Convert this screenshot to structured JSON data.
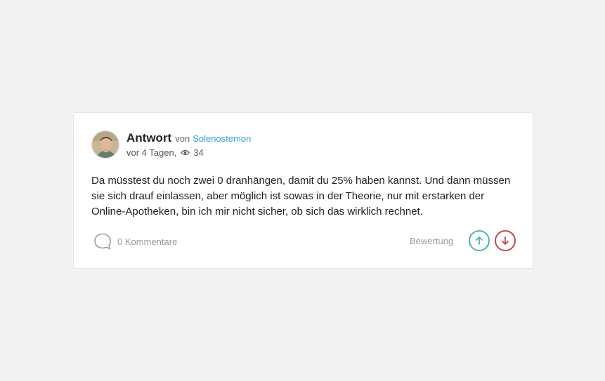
{
  "answer": {
    "title": "Antwort",
    "by_label": "von",
    "author": "Solenostemon",
    "time": "vor 4 Tagen,",
    "views": "34",
    "body": "Da müsstest du noch zwei 0 dranhängen, damit du 25% haben kannst. Und dann müssen sie sich drauf einlassen, aber möglich ist sowas in der Theorie, nur mit erstarken der Online-Apotheken, bin ich mir nicht sicher, ob sich das wirklich rechnet."
  },
  "footer": {
    "comments_label": "0 Kommentare",
    "rating_label": "Bewertung"
  },
  "icons": {
    "avatar": "user-avatar",
    "views": "eye-icon",
    "comments": "speech-bubble-icon",
    "upvote": "arrow-up-icon",
    "downvote": "arrow-down-icon"
  },
  "colors": {
    "author_link": "#3a9fd1",
    "upvote": "#4ab5ae",
    "downvote": "#c94545",
    "muted": "#9a9a9a"
  }
}
